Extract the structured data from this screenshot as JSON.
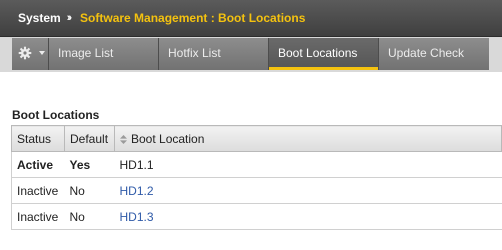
{
  "breadcrumb": {
    "root": "System",
    "separator": "››",
    "current": "Software Management : Boot Locations"
  },
  "tabs": [
    {
      "label": "Image List"
    },
    {
      "label": "Hotfix List"
    },
    {
      "label": "Boot Locations",
      "active": true
    },
    {
      "label": "Update Check"
    }
  ],
  "section": {
    "title": "Boot Locations"
  },
  "table": {
    "headers": {
      "status": "Status",
      "default": "Default",
      "location": "Boot Location"
    },
    "rows": [
      {
        "status": "Active",
        "default": "Yes",
        "location": "HD1.1",
        "link": false
      },
      {
        "status": "Inactive",
        "default": "No",
        "location": "HD1.2",
        "link": true
      },
      {
        "status": "Inactive",
        "default": "No",
        "location": "HD1.3",
        "link": true
      }
    ]
  },
  "colors": {
    "accent": "#f4c20f",
    "link": "#2f5aa8"
  }
}
